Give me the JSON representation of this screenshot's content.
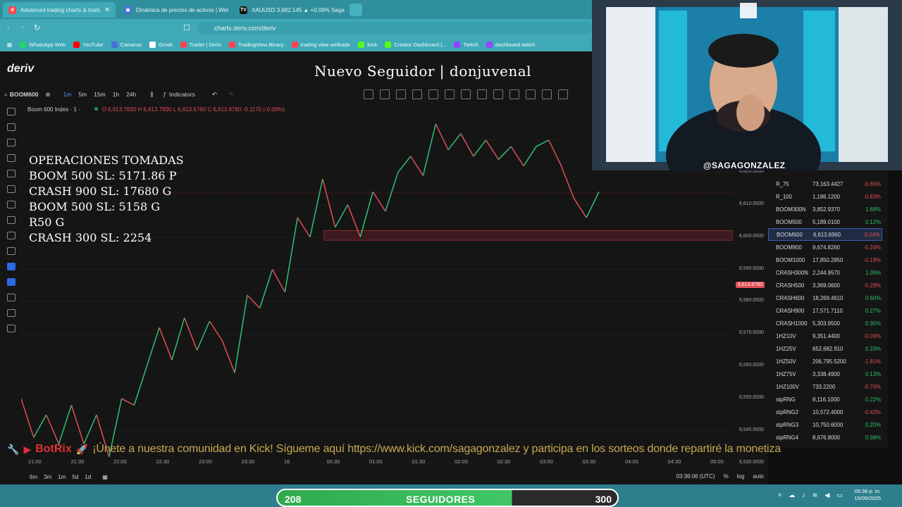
{
  "browser": {
    "tabs": [
      {
        "label": "Advanced trading charts & tools",
        "icon": "deriv-icon",
        "active": true
      },
      {
        "label": "Dinámica de precios de activos | Wel",
        "icon": "page-icon",
        "active": false
      },
      {
        "label": "XAUUSD 3,682.145 ▲ +0.09% Saga",
        "icon": "tradingview-icon",
        "active": false
      }
    ],
    "url": "charts.deriv.com/deriv",
    "bookmarks": [
      {
        "label": "WhatsApp Web",
        "color": "#25d366"
      },
      {
        "label": "YouTube",
        "color": "#ff0000"
      },
      {
        "label": "Camaras",
        "color": "#4a6fd8"
      },
      {
        "label": "Gmail",
        "color": "#ffffff"
      },
      {
        "label": "Trader | Deriv",
        "color": "#ff444f"
      },
      {
        "label": "TradingView Binary",
        "color": "#ff444f"
      },
      {
        "label": "trading view weltrade",
        "color": "#ff444f"
      },
      {
        "label": "Kick",
        "color": "#53fc18"
      },
      {
        "label": "Creator Dashboard |...",
        "color": "#53fc18"
      },
      {
        "label": "Twitch",
        "color": "#9146ff"
      },
      {
        "label": "dashboard twitch",
        "color": "#9146ff"
      }
    ]
  },
  "app": {
    "brand": "deriv",
    "alert": "Nuevo Seguidor | donjuvenal",
    "symbol": "BOOM600",
    "timeframes": [
      "1m",
      "5m",
      "15m",
      "1h",
      "24h"
    ],
    "indicators_label": "Indicators",
    "legend_title": "Boom 600 Index · 1 ·",
    "legend_ohlc": "O 6,613.7830  H 6,613.7830  L 6,613.6760  C 6,613.6760 -0.1170 (-0.00%)",
    "operations": "OPERACIONES TOMADAS\nBOOM 500 SL: 5171.86 P\nCRASH 900 SL: 17680 G\nBOOM 500 SL: 5158 G\nR50 G\nCRASH 300 SL: 2254",
    "current_price": "6,613.6760",
    "bottom_ranges": [
      "6m",
      "3m",
      "1m",
      "5d",
      "1d"
    ],
    "clock_utc": "03:36:06 (UTC)",
    "bottom_opts": [
      "%",
      "log",
      "auto"
    ]
  },
  "ticker": {
    "bot": "BotRix",
    "message": "¡Únete a nuestra comunidad en Kick! Sígueme aquí https://www.kick.com/sagagonzalez y participa en los sorteos donde repartiré la monetiza"
  },
  "watchlist": [
    {
      "symbol": "R_75",
      "price": "73,163.4427",
      "pct": "-0.65%",
      "dir": "down"
    },
    {
      "symbol": "R_100",
      "price": "1,186.1200",
      "pct": "-0.83%",
      "dir": "down"
    },
    {
      "symbol": "BOOM300N",
      "price": "3,852.9370",
      "pct": "1.68%",
      "dir": "up"
    },
    {
      "symbol": "BOOM500",
      "price": "5,189.0100",
      "pct": "0.12%",
      "dir": "up"
    },
    {
      "symbol": "BOOM600",
      "price": "6,613.6960",
      "pct": "-0.04%",
      "dir": "down",
      "selected": true
    },
    {
      "symbol": "BOOM900",
      "price": "9,674.8260",
      "pct": "-0.24%",
      "dir": "down"
    },
    {
      "symbol": "BOOM1000",
      "price": "17,850.2850",
      "pct": "-0.19%",
      "dir": "down"
    },
    {
      "symbol": "CRASH300N",
      "price": "2,244.9570",
      "pct": "1.09%",
      "dir": "up"
    },
    {
      "symbol": "CRASH500",
      "price": "3,369.0600",
      "pct": "-0.28%",
      "dir": "down"
    },
    {
      "symbol": "CRASH600",
      "price": "18,269.4610",
      "pct": "0.60%",
      "dir": "up"
    },
    {
      "symbol": "CRASH900",
      "price": "17,571.7110",
      "pct": "0.27%",
      "dir": "up"
    },
    {
      "symbol": "CRASH1000",
      "price": "5,303.9500",
      "pct": "0.35%",
      "dir": "up"
    },
    {
      "symbol": "1HZ10V",
      "price": "9,351.4400",
      "pct": "-0.09%",
      "dir": "down"
    },
    {
      "symbol": "1HZ25V",
      "price": "652,682.910",
      "pct": "0.33%",
      "dir": "up"
    },
    {
      "symbol": "1HZ50V",
      "price": "206,795.5200",
      "pct": "-1.81%",
      "dir": "down"
    },
    {
      "symbol": "1HZ75V",
      "price": "3,338.4900",
      "pct": "0.13%",
      "dir": "up"
    },
    {
      "symbol": "1HZ100V",
      "price": "733.2200",
      "pct": "-0.70%",
      "dir": "down"
    },
    {
      "symbol": "stpRNG",
      "price": "8,116.1000",
      "pct": "0.22%",
      "dir": "up"
    },
    {
      "symbol": "stpRNG2",
      "price": "10,572.4000",
      "pct": "-0.43%",
      "dir": "down"
    },
    {
      "symbol": "stpRNG3",
      "price": "10,750.6000",
      "pct": "0.20%",
      "dir": "up"
    },
    {
      "symbol": "stpRNG4",
      "price": "8,676.8000",
      "pct": "0.98%",
      "dir": "up"
    }
  ],
  "webcam": {
    "handle": "@SAGAGONZALEZ"
  },
  "goal": {
    "current": "208",
    "label": "SEGUIDORES",
    "target": "300",
    "progress": 0.69
  },
  "taskbar": {
    "time": "09:36 p. m.",
    "date": "15/09/2025"
  },
  "chart_data": {
    "type": "line",
    "series": [
      {
        "values": [
          6550,
          6538,
          6545,
          6536,
          6548,
          6536,
          6545,
          6532,
          6550,
          6548,
          6560,
          6572,
          6562,
          6575,
          6565,
          6574,
          6568,
          6558,
          6582,
          6578,
          6590,
          6583,
          6606,
          6600,
          6618,
          6603,
          6610,
          6600,
          6614,
          6608,
          6620,
          6625,
          6619,
          6635,
          6627,
          6632,
          6625,
          6630,
          6624,
          6628,
          6622,
          6628,
          6630,
          6622,
          6612,
          6606,
          6614
        ]
      }
    ],
    "ylim": [
      6530,
      6640
    ],
    "y_ticks": [
      "6,630.0000",
      "6,620.0000",
      "6,610.0000",
      "6,600.0000",
      "6,590.0000",
      "6,580.0000",
      "6,570.0000",
      "6,560.0000",
      "6,550.0000",
      "6,540.0000",
      "6,530.0000"
    ],
    "x_ticks": [
      "21:00",
      "21:30",
      "22:00",
      "22:30",
      "23:00",
      "23:30",
      "16",
      "00:30",
      "01:00",
      "01:30",
      "02:00",
      "02:30",
      "03:00",
      "03:30",
      "04:00",
      "04:30",
      "05:00"
    ],
    "zone": [
      6599,
      6602
    ],
    "last_value": 6613.676
  }
}
